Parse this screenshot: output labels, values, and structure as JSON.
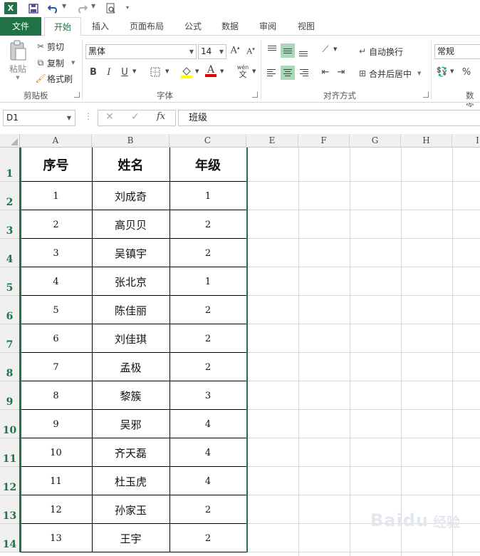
{
  "qat": {
    "logo": "X",
    "save_icon": "save-icon",
    "undo_icon": "undo-icon",
    "redo_icon": "redo-icon",
    "preview_icon": "print-preview-icon"
  },
  "tabs": [
    {
      "label": "文件"
    },
    {
      "label": "开始"
    },
    {
      "label": "插入"
    },
    {
      "label": "页面布局"
    },
    {
      "label": "公式"
    },
    {
      "label": "数据"
    },
    {
      "label": "审阅"
    },
    {
      "label": "视图"
    }
  ],
  "ribbon": {
    "clipboard": {
      "paste": "粘贴",
      "cut": "剪切",
      "copy": "复制",
      "format_painter": "格式刷",
      "label": "剪贴板"
    },
    "font": {
      "name": "黑体",
      "size": "14",
      "bold": "B",
      "italic": "I",
      "underline": "U",
      "grow": "A",
      "shrink": "A",
      "font_color_glyph": "A",
      "phonetic": "wén",
      "label": "字体"
    },
    "alignment": {
      "wrap": "自动换行",
      "merge": "合并后居中",
      "label": "对齐方式"
    },
    "number": {
      "format": "常规",
      "percent": "%",
      "label": "数字"
    }
  },
  "formula_bar": {
    "name_box": "D1",
    "fx": "fx",
    "value": "班级"
  },
  "columns": [
    "A",
    "B",
    "C",
    "E",
    "F",
    "G",
    "H",
    "I"
  ],
  "rows": [
    "1",
    "2",
    "3",
    "4",
    "5",
    "6",
    "7",
    "8",
    "9",
    "10",
    "11",
    "12",
    "13",
    "14"
  ],
  "table": {
    "headers": [
      "序号",
      "姓名",
      "年级"
    ],
    "rows": [
      [
        "1",
        "刘成奇",
        "1"
      ],
      [
        "2",
        "高贝贝",
        "2"
      ],
      [
        "3",
        "吴镇宇",
        "2"
      ],
      [
        "4",
        "张北京",
        "1"
      ],
      [
        "5",
        "陈佳丽",
        "2"
      ],
      [
        "6",
        "刘佳琪",
        "2"
      ],
      [
        "7",
        "孟极",
        "2"
      ],
      [
        "8",
        "黎簇",
        "3"
      ],
      [
        "9",
        "吴邪",
        "4"
      ],
      [
        "10",
        "齐天磊",
        "4"
      ],
      [
        "11",
        "杜玉虎",
        "4"
      ],
      [
        "12",
        "孙家玉",
        "2"
      ],
      [
        "13",
        "王宇",
        "2"
      ]
    ]
  },
  "watermark": {
    "text": "Baidu",
    "sub": "经验"
  },
  "colors": {
    "accent": "#217346",
    "align_selected": "#a9d8b7"
  }
}
